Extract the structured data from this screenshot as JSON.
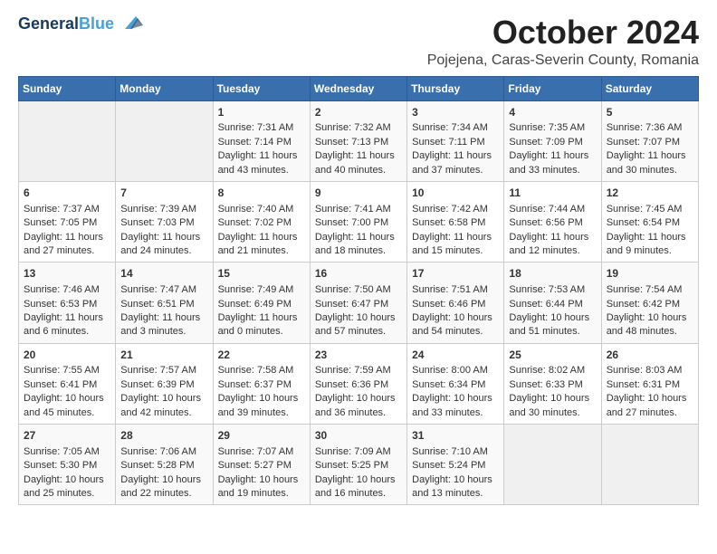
{
  "header": {
    "logo_general": "General",
    "logo_blue": "Blue",
    "month_title": "October 2024",
    "location": "Pojejena, Caras-Severin County, Romania"
  },
  "weekdays": [
    "Sunday",
    "Monday",
    "Tuesday",
    "Wednesday",
    "Thursday",
    "Friday",
    "Saturday"
  ],
  "weeks": [
    [
      {
        "day": "",
        "empty": true
      },
      {
        "day": "",
        "empty": true
      },
      {
        "day": "1",
        "line1": "Sunrise: 7:31 AM",
        "line2": "Sunset: 7:14 PM",
        "line3": "Daylight: 11 hours and 43 minutes."
      },
      {
        "day": "2",
        "line1": "Sunrise: 7:32 AM",
        "line2": "Sunset: 7:13 PM",
        "line3": "Daylight: 11 hours and 40 minutes."
      },
      {
        "day": "3",
        "line1": "Sunrise: 7:34 AM",
        "line2": "Sunset: 7:11 PM",
        "line3": "Daylight: 11 hours and 37 minutes."
      },
      {
        "day": "4",
        "line1": "Sunrise: 7:35 AM",
        "line2": "Sunset: 7:09 PM",
        "line3": "Daylight: 11 hours and 33 minutes."
      },
      {
        "day": "5",
        "line1": "Sunrise: 7:36 AM",
        "line2": "Sunset: 7:07 PM",
        "line3": "Daylight: 11 hours and 30 minutes."
      }
    ],
    [
      {
        "day": "6",
        "line1": "Sunrise: 7:37 AM",
        "line2": "Sunset: 7:05 PM",
        "line3": "Daylight: 11 hours and 27 minutes."
      },
      {
        "day": "7",
        "line1": "Sunrise: 7:39 AM",
        "line2": "Sunset: 7:03 PM",
        "line3": "Daylight: 11 hours and 24 minutes."
      },
      {
        "day": "8",
        "line1": "Sunrise: 7:40 AM",
        "line2": "Sunset: 7:02 PM",
        "line3": "Daylight: 11 hours and 21 minutes."
      },
      {
        "day": "9",
        "line1": "Sunrise: 7:41 AM",
        "line2": "Sunset: 7:00 PM",
        "line3": "Daylight: 11 hours and 18 minutes."
      },
      {
        "day": "10",
        "line1": "Sunrise: 7:42 AM",
        "line2": "Sunset: 6:58 PM",
        "line3": "Daylight: 11 hours and 15 minutes."
      },
      {
        "day": "11",
        "line1": "Sunrise: 7:44 AM",
        "line2": "Sunset: 6:56 PM",
        "line3": "Daylight: 11 hours and 12 minutes."
      },
      {
        "day": "12",
        "line1": "Sunrise: 7:45 AM",
        "line2": "Sunset: 6:54 PM",
        "line3": "Daylight: 11 hours and 9 minutes."
      }
    ],
    [
      {
        "day": "13",
        "line1": "Sunrise: 7:46 AM",
        "line2": "Sunset: 6:53 PM",
        "line3": "Daylight: 11 hours and 6 minutes."
      },
      {
        "day": "14",
        "line1": "Sunrise: 7:47 AM",
        "line2": "Sunset: 6:51 PM",
        "line3": "Daylight: 11 hours and 3 minutes."
      },
      {
        "day": "15",
        "line1": "Sunrise: 7:49 AM",
        "line2": "Sunset: 6:49 PM",
        "line3": "Daylight: 11 hours and 0 minutes."
      },
      {
        "day": "16",
        "line1": "Sunrise: 7:50 AM",
        "line2": "Sunset: 6:47 PM",
        "line3": "Daylight: 10 hours and 57 minutes."
      },
      {
        "day": "17",
        "line1": "Sunrise: 7:51 AM",
        "line2": "Sunset: 6:46 PM",
        "line3": "Daylight: 10 hours and 54 minutes."
      },
      {
        "day": "18",
        "line1": "Sunrise: 7:53 AM",
        "line2": "Sunset: 6:44 PM",
        "line3": "Daylight: 10 hours and 51 minutes."
      },
      {
        "day": "19",
        "line1": "Sunrise: 7:54 AM",
        "line2": "Sunset: 6:42 PM",
        "line3": "Daylight: 10 hours and 48 minutes."
      }
    ],
    [
      {
        "day": "20",
        "line1": "Sunrise: 7:55 AM",
        "line2": "Sunset: 6:41 PM",
        "line3": "Daylight: 10 hours and 45 minutes."
      },
      {
        "day": "21",
        "line1": "Sunrise: 7:57 AM",
        "line2": "Sunset: 6:39 PM",
        "line3": "Daylight: 10 hours and 42 minutes."
      },
      {
        "day": "22",
        "line1": "Sunrise: 7:58 AM",
        "line2": "Sunset: 6:37 PM",
        "line3": "Daylight: 10 hours and 39 minutes."
      },
      {
        "day": "23",
        "line1": "Sunrise: 7:59 AM",
        "line2": "Sunset: 6:36 PM",
        "line3": "Daylight: 10 hours and 36 minutes."
      },
      {
        "day": "24",
        "line1": "Sunrise: 8:00 AM",
        "line2": "Sunset: 6:34 PM",
        "line3": "Daylight: 10 hours and 33 minutes."
      },
      {
        "day": "25",
        "line1": "Sunrise: 8:02 AM",
        "line2": "Sunset: 6:33 PM",
        "line3": "Daylight: 10 hours and 30 minutes."
      },
      {
        "day": "26",
        "line1": "Sunrise: 8:03 AM",
        "line2": "Sunset: 6:31 PM",
        "line3": "Daylight: 10 hours and 27 minutes."
      }
    ],
    [
      {
        "day": "27",
        "line1": "Sunrise: 7:05 AM",
        "line2": "Sunset: 5:30 PM",
        "line3": "Daylight: 10 hours and 25 minutes."
      },
      {
        "day": "28",
        "line1": "Sunrise: 7:06 AM",
        "line2": "Sunset: 5:28 PM",
        "line3": "Daylight: 10 hours and 22 minutes."
      },
      {
        "day": "29",
        "line1": "Sunrise: 7:07 AM",
        "line2": "Sunset: 5:27 PM",
        "line3": "Daylight: 10 hours and 19 minutes."
      },
      {
        "day": "30",
        "line1": "Sunrise: 7:09 AM",
        "line2": "Sunset: 5:25 PM",
        "line3": "Daylight: 10 hours and 16 minutes."
      },
      {
        "day": "31",
        "line1": "Sunrise: 7:10 AM",
        "line2": "Sunset: 5:24 PM",
        "line3": "Daylight: 10 hours and 13 minutes."
      },
      {
        "day": "",
        "empty": true
      },
      {
        "day": "",
        "empty": true
      }
    ]
  ]
}
